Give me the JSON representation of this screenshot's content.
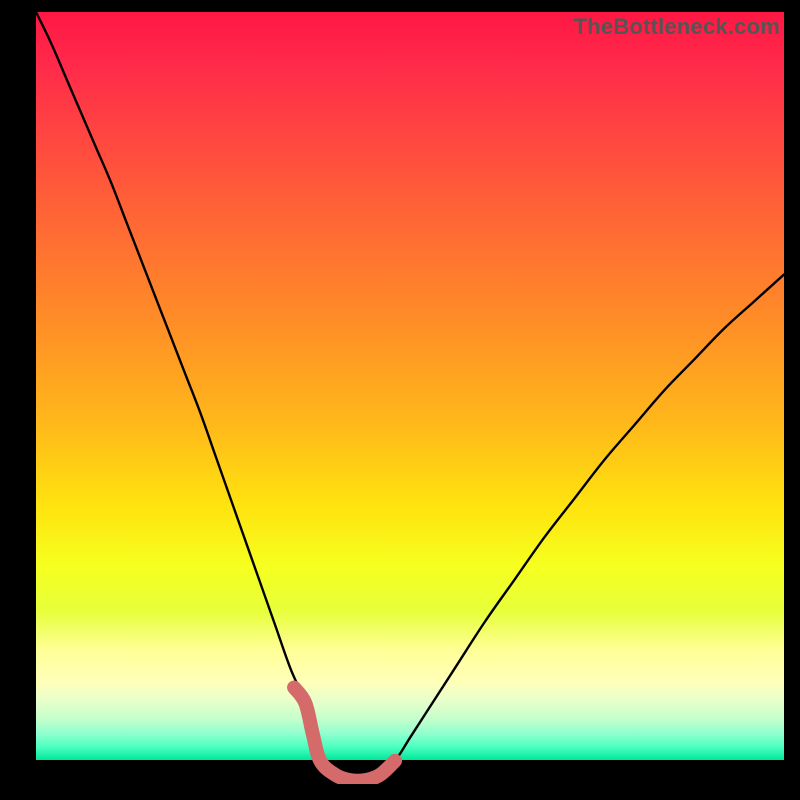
{
  "watermark": "TheBottleneck.com",
  "colors": {
    "frame": "#000000",
    "curve_stroke": "#000000",
    "highlight_stroke": "#d46a6a",
    "gradient_stops": [
      {
        "offset": 0.0,
        "color": "#ff1744"
      },
      {
        "offset": 0.07,
        "color": "#ff2a4a"
      },
      {
        "offset": 0.18,
        "color": "#ff4a3f"
      },
      {
        "offset": 0.3,
        "color": "#ff6d33"
      },
      {
        "offset": 0.42,
        "color": "#ff8f26"
      },
      {
        "offset": 0.55,
        "color": "#ffb81a"
      },
      {
        "offset": 0.66,
        "color": "#ffe30f"
      },
      {
        "offset": 0.74,
        "color": "#f6ff1f"
      },
      {
        "offset": 0.8,
        "color": "#e7ff3a"
      },
      {
        "offset": 0.855,
        "color": "#ffff99"
      },
      {
        "offset": 0.895,
        "color": "#ffffb8"
      },
      {
        "offset": 0.92,
        "color": "#e8ffca"
      },
      {
        "offset": 0.945,
        "color": "#c4ffcc"
      },
      {
        "offset": 0.965,
        "color": "#8fffce"
      },
      {
        "offset": 0.983,
        "color": "#4affc0"
      },
      {
        "offset": 1.0,
        "color": "#00e89a"
      }
    ]
  },
  "chart_data": {
    "type": "line",
    "title": "",
    "xlabel": "",
    "ylabel": "",
    "xlim": [
      0,
      100
    ],
    "ylim": [
      0,
      100
    ],
    "grid": false,
    "legend": false,
    "x": [
      0,
      2,
      4,
      6,
      8,
      10,
      12,
      14,
      16,
      18,
      20,
      22,
      24,
      26,
      28,
      30,
      32,
      34,
      36,
      37,
      38,
      40,
      42,
      44,
      46,
      48,
      50,
      52,
      56,
      60,
      64,
      68,
      72,
      76,
      80,
      84,
      88,
      92,
      96,
      100
    ],
    "values": [
      100,
      96,
      91.5,
      87,
      82.5,
      78,
      73,
      68,
      63,
      58,
      53,
      48,
      42.5,
      37,
      31.5,
      26,
      20.5,
      15,
      10.5,
      6.5,
      3.0,
      1.2,
      0.5,
      0.5,
      1.2,
      3.0,
      6.0,
      9.0,
      15.0,
      21.0,
      26.5,
      32.0,
      37.0,
      42.0,
      46.5,
      51.0,
      55.0,
      59.0,
      62.5,
      66.0
    ],
    "highlight_segment": {
      "x": [
        34.5,
        36,
        37,
        38,
        40,
        42,
        44,
        46,
        48
      ],
      "values": [
        12.5,
        10.5,
        6.5,
        3.0,
        1.2,
        0.5,
        0.5,
        1.2,
        3.0
      ]
    }
  }
}
